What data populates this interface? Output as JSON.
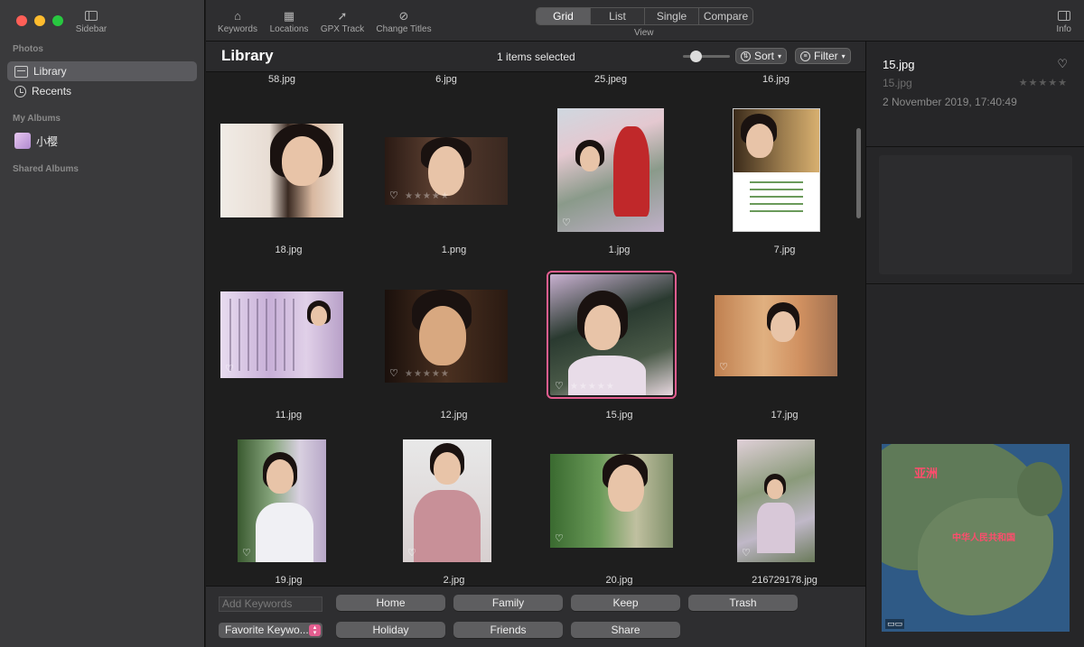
{
  "sidebar": {
    "toggle_label": "Sidebar",
    "photos_heading": "Photos",
    "items": [
      {
        "label": "Library",
        "icon": "library-icon"
      },
      {
        "label": "Recents",
        "icon": "clock-icon"
      }
    ],
    "albums_heading": "My Albums",
    "albums": [
      {
        "label": "小樱",
        "icon": "album-icon"
      }
    ],
    "shared_heading": "Shared Albums"
  },
  "toolbar": {
    "tools": [
      {
        "label": "Keywords",
        "glyph": "⌂"
      },
      {
        "label": "Locations",
        "glyph": "▦"
      },
      {
        "label": "GPX Track",
        "glyph": "➚"
      },
      {
        "label": "Change Titles",
        "glyph": "⊘"
      }
    ],
    "view_modes": [
      "Grid",
      "List",
      "Single",
      "Compare"
    ],
    "active_view": "Grid",
    "view_label": "View",
    "info_label": "Info"
  },
  "header": {
    "title": "Library",
    "selection": "1 items selected",
    "sort_label": "Sort",
    "filter_label": "Filter"
  },
  "grid": {
    "top_row_labels": [
      "58.jpg",
      "6.jpg",
      "25.jpeg",
      "16.jpg"
    ],
    "rows": [
      [
        "18.jpg",
        "1.png",
        "1.jpg",
        "7.jpg"
      ],
      [
        "11.jpg",
        "12.jpg",
        "15.jpg",
        "17.jpg"
      ],
      [
        "19.jpg",
        "2.jpg",
        "20.jpg",
        "216729178.jpg"
      ]
    ],
    "selected": "15.jpg",
    "stars": "★★★★★",
    "heart": "♡"
  },
  "keywords": {
    "input_placeholder": "Add Keywords",
    "favorite_select": "Favorite Keywo...",
    "row1": [
      "Home",
      "Family",
      "Keep",
      "Trash"
    ],
    "row2": [
      "Holiday",
      "Friends",
      "Share"
    ]
  },
  "info": {
    "name": "15.jpg",
    "subtitle": "15.jpg",
    "date": "2 November 2019, 17:40:49",
    "stars": "★★★★★",
    "heart": "♡",
    "map_labels": [
      "亚洲",
      "中华人民共和国"
    ]
  },
  "colors": {
    "accent": "#e35d8f",
    "sidebar_bg": "#3a3a3c",
    "grid_bg": "#1e1e1e"
  }
}
